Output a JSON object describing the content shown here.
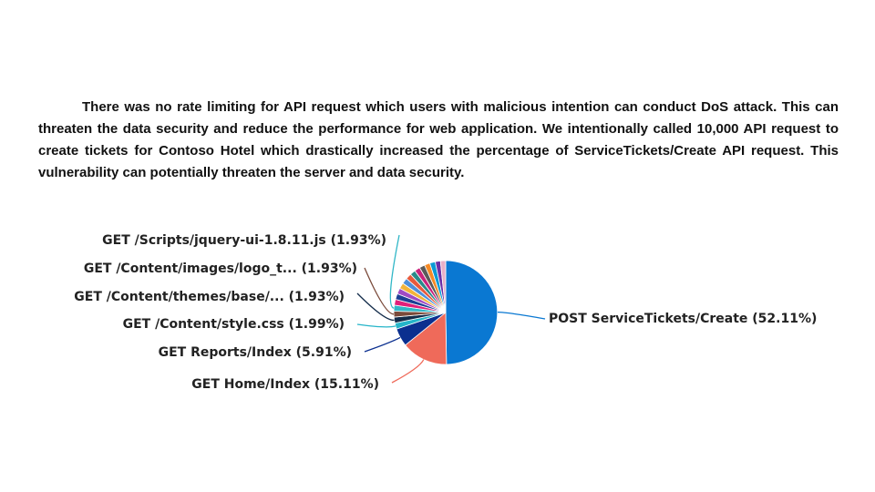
{
  "paragraph": {
    "before": "There was no rate limiting for API request which users with malicious intention can conduct DoS attack. This can threaten the data security and reduce the performance for web application. We intentionally called ",
    "strong": "10,000",
    "after": " API request to create tickets for Contoso Hotel which drastically increased the percentage of ServiceTickets/Create API request. This vulnerability can potentially threaten the server and data security."
  },
  "chart_data": {
    "type": "pie",
    "legend": "callout labels",
    "slices": [
      {
        "label": "POST ServiceTickets/Create (52.11%)",
        "value": 52.11,
        "color": "#0a78d2"
      },
      {
        "label": "GET Home/Index (15.11%)",
        "value": 15.11,
        "color": "#ef6a5a"
      },
      {
        "label": "GET Reports/Index (5.91%)",
        "value": 5.91,
        "color": "#0b2f8f"
      },
      {
        "label": "GET /Content/style.css (1.99%)",
        "value": 1.99,
        "color": "#26b5c9"
      },
      {
        "label": "GET /Content/themes/base/... (1.93%)",
        "value": 1.93,
        "color": "#132c4a"
      },
      {
        "label": "GET /Content/images/logo_t... (1.93%)",
        "value": 1.93,
        "color": "#7a4a3a"
      },
      {
        "label": "GET /Scripts/jquery-ui-1.8.11.js (1.93%)",
        "value": 1.93,
        "color": "#31b7c7"
      },
      {
        "label": "",
        "value": 1.9,
        "color": "#e0207a"
      },
      {
        "label": "",
        "value": 1.9,
        "color": "#1c3f95"
      },
      {
        "label": "",
        "value": 1.9,
        "color": "#a04bc4"
      },
      {
        "label": "",
        "value": 1.9,
        "color": "#f3b43a"
      },
      {
        "label": "",
        "value": 1.9,
        "color": "#4f8fd9"
      },
      {
        "label": "",
        "value": 1.9,
        "color": "#e85a3c"
      },
      {
        "label": "",
        "value": 1.8,
        "color": "#2a8a8a"
      },
      {
        "label": "",
        "value": 1.8,
        "color": "#c9237c"
      },
      {
        "label": "",
        "value": 1.8,
        "color": "#5a5a5a"
      },
      {
        "label": "",
        "value": 1.8,
        "color": "#f58a26"
      },
      {
        "label": "",
        "value": 1.8,
        "color": "#0a9ad6"
      },
      {
        "label": "",
        "value": 1.7,
        "color": "#6b2fa8"
      },
      {
        "label": "",
        "value": 1.7,
        "color": "#e8b0c8"
      }
    ]
  }
}
